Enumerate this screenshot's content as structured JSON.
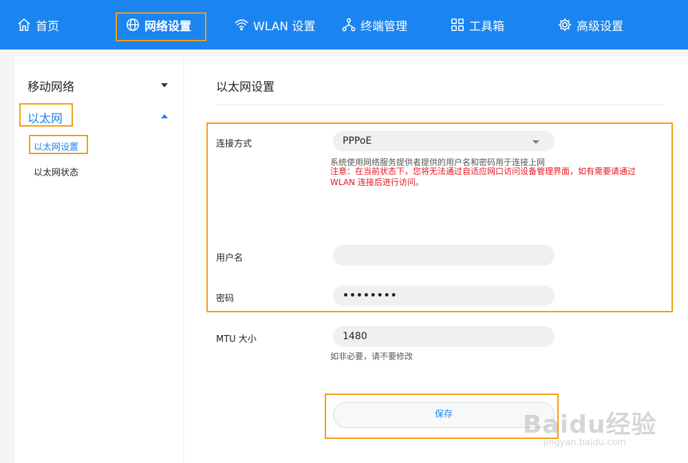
{
  "nav": {
    "home": "首页",
    "network": "网络设置",
    "wlan": "WLAN 设置",
    "terminal": "终端管理",
    "toolbox": "工具箱",
    "advanced": "高级设置"
  },
  "sidebar": {
    "mobile_network": "移动网络",
    "ethernet": "以太网",
    "ethernet_settings": "以太网设置",
    "ethernet_status": "以太网状态"
  },
  "main": {
    "title": "以太网设置",
    "connection_label": "连接方式",
    "connection_value": "PPPoE",
    "connection_hint": "系统使用网络服务提供者提供的用户名和密码用于连接上网",
    "warning": "注意：在当前状态下，您将无法通过自适应网口访问设备管理界面，如有需要请通过 WLAN 连接后进行访问。",
    "username_label": "用户名",
    "username_value": "",
    "password_label": "密码",
    "password_value": "••••••••",
    "mtu_label": "MTU 大小",
    "mtu_value": "1480",
    "mtu_hint": "如非必要，请不要修改",
    "save_label": "保存"
  },
  "watermark": {
    "logo": "Baidu经验",
    "sub": "jingyan.baidu.com"
  },
  "colors": {
    "brand": "#1a85f0",
    "highlight": "#f39c12",
    "warning": "#e8141e"
  }
}
